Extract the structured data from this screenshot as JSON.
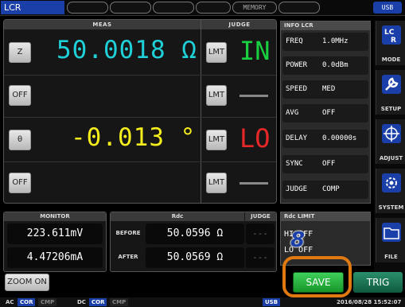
{
  "topbar": {
    "mode": "LCR",
    "memory": "MEMORY",
    "usb": "USB"
  },
  "meas_panel": {
    "meas_header": "MEAS",
    "judge_header": "JUDGE",
    "rows": [
      {
        "param": "Z",
        "value": "50.0018 Ω",
        "value_color": "#1fd0d8",
        "judge_btn": "LMT",
        "judge": "IN",
        "judge_color": "#19d040"
      },
      {
        "param": "OFF",
        "value": "",
        "judge_btn": "LMT",
        "judge": ""
      },
      {
        "param": "θ",
        "value": "-0.013 °",
        "value_color": "#f5ee1c",
        "judge_btn": "LMT",
        "judge": "LO",
        "judge_color": "#e82828"
      },
      {
        "param": "OFF",
        "value": "",
        "judge_btn": "LMT",
        "judge": ""
      }
    ]
  },
  "info_panel": {
    "header": "INFO LCR",
    "items": [
      {
        "key": "FREQ",
        "value": "1.0MHz"
      },
      {
        "key": "POWER",
        "value": "0.0dBm"
      },
      {
        "key": "SPEED",
        "value": "MED"
      },
      {
        "key": "AVG",
        "value": "OFF"
      },
      {
        "key": "DELAY",
        "value": "0.00000s"
      },
      {
        "key": "SYNC",
        "value": "OFF"
      },
      {
        "key": "JUDGE",
        "value": "COMP"
      }
    ]
  },
  "side_menu": {
    "items": [
      {
        "label": "MODE",
        "icon": "lcr-mode-icon"
      },
      {
        "label": "SETUP",
        "icon": "wrench-icon"
      },
      {
        "label": "ADJUST",
        "icon": "crosshair-icon"
      },
      {
        "label": "SYSTEM",
        "icon": "gear-icon"
      },
      {
        "label": "FILE",
        "icon": "folder-icon"
      }
    ]
  },
  "monitor": {
    "header": "MONITOR",
    "voltage": "223.611mV",
    "current": "4.47206mA"
  },
  "rdc": {
    "rdc_header": "Rdc",
    "judge_header": "JUDGE",
    "before_label": "BEFORE",
    "before_value": "50.0596 Ω",
    "after_label": "AFTER",
    "after_value": "50.0569 Ω",
    "judge_before": "---",
    "judge_after": "---"
  },
  "rdc_limit": {
    "header": "Rdc LIMIT",
    "line1": "HI OFF",
    "line2": "LO OFF"
  },
  "buttons": {
    "zoom": "ZOOM ON",
    "save": "SAVE",
    "trig": "TRIG"
  },
  "callout": {
    "step": "8"
  },
  "status": {
    "ac": "AC",
    "ac_cor": "COR",
    "ac_cmp": "CMP",
    "dc": "DC",
    "dc_cor": "COR",
    "dc_cmp": "CMP",
    "usb": "USB",
    "datetime": "2016/08/28 15:52:07"
  }
}
